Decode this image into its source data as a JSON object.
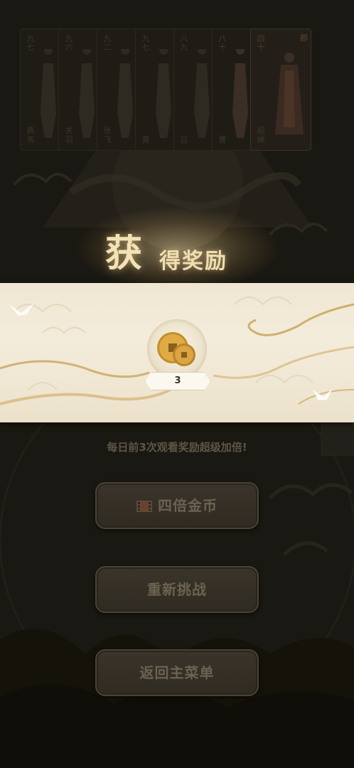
{
  "cards": [
    {
      "num": "九七",
      "name": "典韦"
    },
    {
      "num": "九六",
      "name": "关羽"
    },
    {
      "num": "九二",
      "name": "张飞"
    },
    {
      "num": "九七",
      "name": "黄"
    },
    {
      "num": "八九",
      "name": "吕"
    },
    {
      "num": "八十",
      "name": "曹"
    },
    {
      "num": "四十",
      "name": "貂蝉",
      "corner": "郡"
    }
  ],
  "reward": {
    "title_big": "获",
    "title_rest": "得奖励",
    "item_icon": "copper-coin-icon",
    "count": "3"
  },
  "notice": "每日前3次观看奖励超级加倍!",
  "buttons": {
    "quadruple": "四倍金币",
    "quadruple_icon": "film-icon",
    "retry": "重新挑战",
    "main_menu": "返回主菜单"
  },
  "colors": {
    "background": "#1a1812",
    "scroll": "#efe6d2",
    "gold": "#c9a45a",
    "button_text": "#6b6251"
  }
}
